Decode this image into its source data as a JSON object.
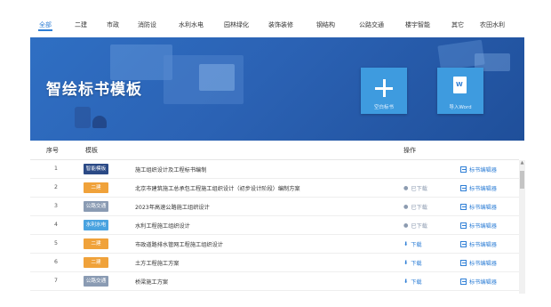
{
  "tabs": [
    {
      "label": "全部",
      "active": true
    },
    {
      "label": "二建"
    },
    {
      "label": "市政"
    },
    {
      "label": "消防设"
    },
    {
      "label": "水利水电"
    },
    {
      "label": "园林绿化"
    },
    {
      "label": "装饰装修"
    },
    {
      "label": "钢结构"
    },
    {
      "label": "公路交通"
    },
    {
      "label": "楼宇智能"
    },
    {
      "label": "其它"
    },
    {
      "label": "农田水利"
    }
  ],
  "banner": {
    "title": "智绘标书模板",
    "create_label": "空白标书",
    "import_label": "导入Word"
  },
  "table": {
    "headers": {
      "num": "序号",
      "template": "模板",
      "action": "操作"
    },
    "rows": [
      {
        "num": "1",
        "tag": "智能模板",
        "tag_color": "#2b4a86",
        "name": "施工组织设计及工程标书编制",
        "download": "",
        "edit": "标书编辑器"
      },
      {
        "num": "2",
        "tag": "二建",
        "tag_color": "#f0a23a",
        "name": "北京市建筑施工总承包工程施工组织设计（初步设计阶段）编制方案",
        "download": "已下载",
        "download_state": "gray",
        "edit": "标书编辑器"
      },
      {
        "num": "3",
        "tag": "公路交通",
        "tag_color": "#8a9bb3",
        "name": "2023年高速公路施工组织设计",
        "download": "已下载",
        "download_state": "gray",
        "edit": "标书编辑器"
      },
      {
        "num": "4",
        "tag": "水利水电",
        "tag_color": "#4aa3e0",
        "name": "水利工程施工组织设计",
        "download": "已下载",
        "download_state": "gray",
        "edit": "标书编辑器"
      },
      {
        "num": "5",
        "tag": "二建",
        "tag_color": "#f0a23a",
        "name": "市政道路排水管网工程施工组织设计",
        "download": "下载",
        "download_state": "blue",
        "edit": "标书编辑器"
      },
      {
        "num": "6",
        "tag": "二建",
        "tag_color": "#f0a23a",
        "name": "土方工程施工方案",
        "download": "下载",
        "download_state": "blue",
        "edit": "标书编辑器"
      },
      {
        "num": "7",
        "tag": "公路交通",
        "tag_color": "#8a9bb3",
        "name": "桥梁施工方案",
        "download": "下载",
        "download_state": "blue",
        "edit": "标书编辑器"
      }
    ]
  },
  "colors": {
    "accent": "#2f7fd6",
    "banner": "#2b62b4",
    "button": "#3e9bdf"
  }
}
